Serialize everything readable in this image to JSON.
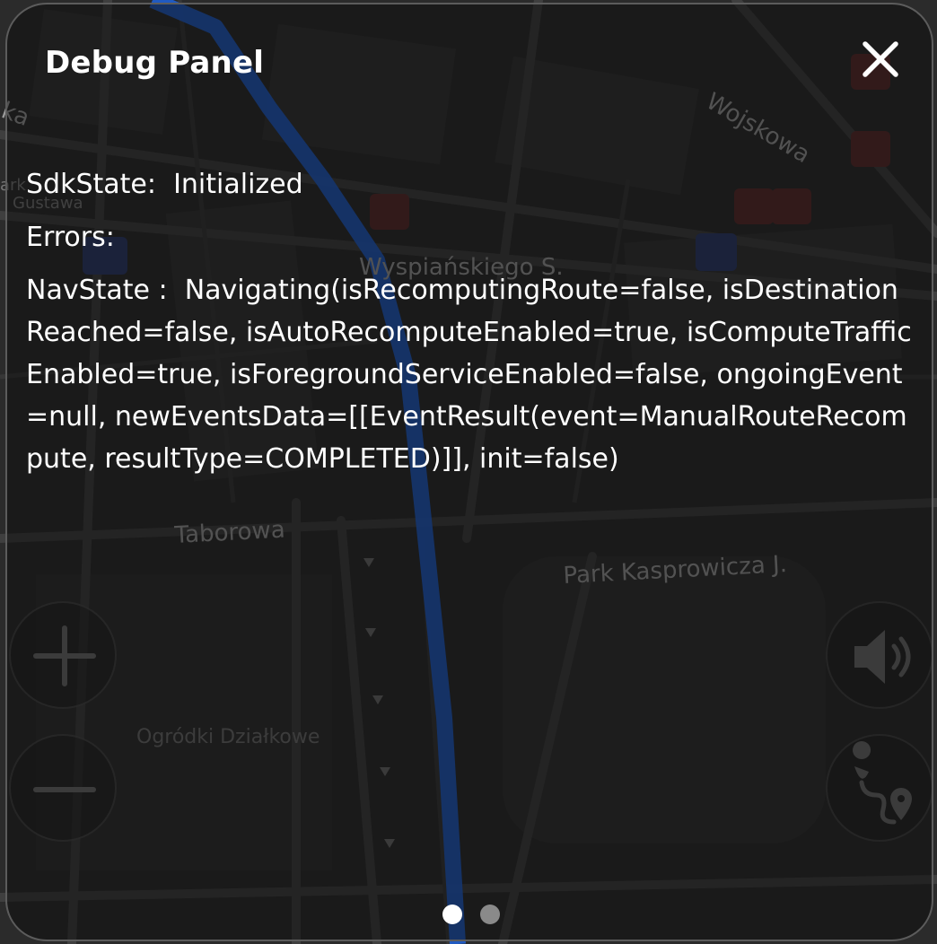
{
  "debug_panel": {
    "title": "Debug Panel",
    "sdk_state_label": "SdkState:",
    "sdk_state_value": "Initialized",
    "errors_label": "Errors:",
    "nav_state_label": "NavState :",
    "nav_state_value": "Navigating(isRecomputingRoute=false, isDestinationReached=false, isAutoRecomputeEnabled=true, isComputeTrafficEnabled=true, isForegroundServiceEnabled=false, ongoingEvent=null, newEventsData=[[EventResult(event=ManualRouteRecompute, resultType=COMPLETED)]], init=false)",
    "close_icon": "close-icon"
  },
  "map": {
    "labels": {
      "wojskowa": "Wojskowa",
      "wyspianskiego": "Wyspiańskiego S.",
      "taborowa": "Taborowa",
      "park": "Park Kasprowicza J.",
      "ogrodki": "Ogródki Działkowe",
      "gustawa": "Gustawa",
      "ark": "ark",
      "ka": "ka"
    },
    "route_color": "#1f5fd1"
  },
  "controls": {
    "zoom_in_icon": "plus-icon",
    "zoom_out_icon": "minus-icon",
    "sound_icon": "speaker-icon",
    "route_icon": "route-icon"
  },
  "pager": {
    "pages": 2,
    "active_page": 1
  }
}
